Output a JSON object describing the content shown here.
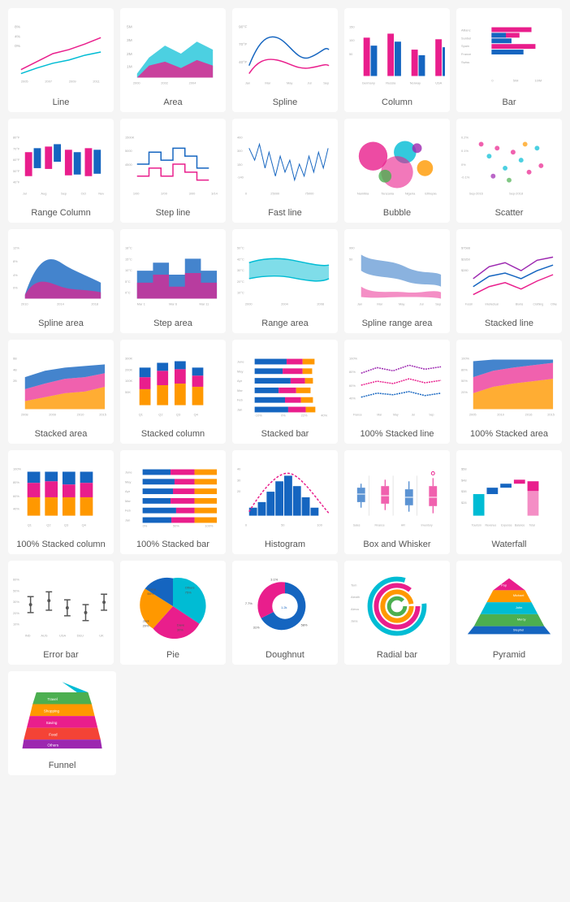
{
  "charts": [
    {
      "id": "line",
      "label": "Line"
    },
    {
      "id": "area",
      "label": "Area"
    },
    {
      "id": "spline",
      "label": "Spline"
    },
    {
      "id": "column",
      "label": "Column"
    },
    {
      "id": "bar",
      "label": "Bar"
    },
    {
      "id": "range-column",
      "label": "Range Column"
    },
    {
      "id": "step-line",
      "label": "Step line"
    },
    {
      "id": "fast-line",
      "label": "Fast line"
    },
    {
      "id": "bubble",
      "label": "Bubble"
    },
    {
      "id": "scatter",
      "label": "Scatter"
    },
    {
      "id": "spline-area",
      "label": "Spline area"
    },
    {
      "id": "step-area",
      "label": "Step area"
    },
    {
      "id": "range-area",
      "label": "Range area"
    },
    {
      "id": "spline-range-area",
      "label": "Spline range area"
    },
    {
      "id": "stacked-line",
      "label": "Stacked line"
    },
    {
      "id": "stacked-area",
      "label": "Stacked area"
    },
    {
      "id": "stacked-column",
      "label": "Stacked column"
    },
    {
      "id": "stacked-bar",
      "label": "Stacked bar"
    },
    {
      "id": "100-stacked-line",
      "label": "100% Stacked line"
    },
    {
      "id": "100-stacked-area",
      "label": "100% Stacked area"
    },
    {
      "id": "100-stacked-column",
      "label": "100% Stacked column"
    },
    {
      "id": "100-stacked-bar",
      "label": "100% Stacked bar"
    },
    {
      "id": "histogram",
      "label": "Histogram"
    },
    {
      "id": "box-whisker",
      "label": "Box and Whisker"
    },
    {
      "id": "waterfall",
      "label": "Waterfall"
    },
    {
      "id": "error-bar",
      "label": "Error bar"
    },
    {
      "id": "pie",
      "label": "Pie"
    },
    {
      "id": "doughnut",
      "label": "Doughnut"
    },
    {
      "id": "radial-bar",
      "label": "Radial bar"
    },
    {
      "id": "pyramid",
      "label": "Pyramid"
    },
    {
      "id": "funnel",
      "label": "Funnel"
    }
  ]
}
